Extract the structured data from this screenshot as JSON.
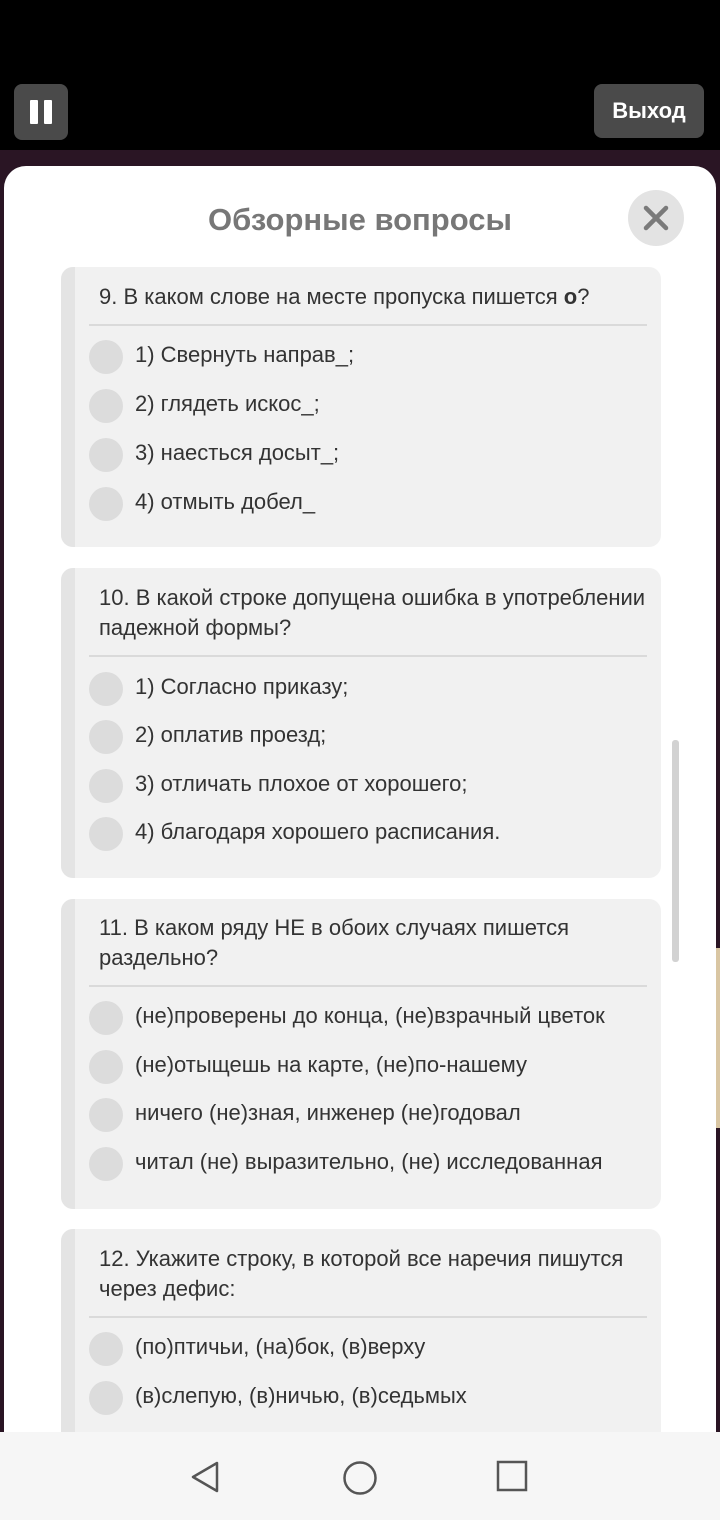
{
  "top_bar": {
    "exit_label": "Выход"
  },
  "modal": {
    "title": "Обзорные вопросы"
  },
  "questions": [
    {
      "text_before": "9. В каком слове на месте пропуска пишется ",
      "text_bold": "о",
      "text_after": "?",
      "options": [
        "1) Свернуть направ_;",
        "2) глядеть искос_;",
        "3) наесться досыт_;",
        "4) отмыть добел_"
      ]
    },
    {
      "text": "10. В какой строке допущена ошибка в употреблении падежной формы?",
      "options": [
        "1) Согласно приказу;",
        "2) оплатив проезд;",
        "3) отличать плохое от хорошего;",
        "4) благодаря хорошего расписания."
      ]
    },
    {
      "text": "11. В каком ряду НЕ в обоих случаях пишется раздельно?",
      "options": [
        "(не)проверены до конца, (не)взрачный цветок",
        "(не)отыщешь на карте, (не)по-нашему",
        "ничего (не)зная, инженер (не)годовал",
        "читал (не) выразительно, (не) исследованная"
      ]
    },
    {
      "text": "12. Укажите строку, в которой все наречия пишутся через дефис:",
      "options": [
        "(по)птичьи, (на)бок, (в)верху",
        "(в)слепую, (в)ничью, (в)седьмых"
      ]
    }
  ],
  "icons": {
    "pause": "pause-icon",
    "close": "close-icon",
    "nav_back": "back-triangle-icon",
    "nav_home": "home-circle-icon",
    "nav_recent": "recent-square-icon"
  },
  "colors": {
    "card_bg": "#f1f1f1",
    "button_bg": "#4a4a4a",
    "backdrop": "#2a1524"
  }
}
